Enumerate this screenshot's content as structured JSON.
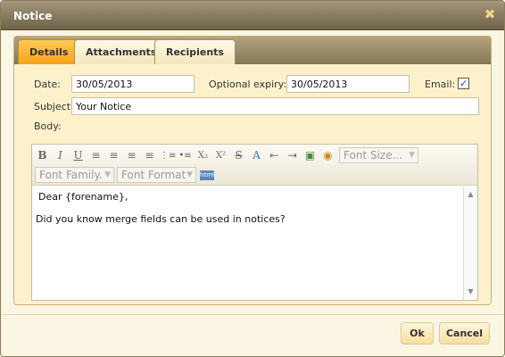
{
  "dialog": {
    "title": "Notice",
    "close_icon": "✖"
  },
  "tabs": [
    {
      "label": "Details",
      "active": true
    },
    {
      "label": "Attachments",
      "active": false
    },
    {
      "label": "Recipients",
      "active": false
    }
  ],
  "form": {
    "date_label": "Date:",
    "date_value": "30/05/2013",
    "expiry_label": "Optional expiry:",
    "expiry_value": "30/05/2013",
    "email_label": "Email:",
    "email_checked": true,
    "email_check_glyph": "✓",
    "subject_label": "Subject",
    "subject_value": "Your Notice",
    "body_label": "Body:"
  },
  "editor": {
    "toolbar": {
      "buttons": [
        {
          "name": "bold-icon",
          "glyph": "B"
        },
        {
          "name": "italic-icon",
          "glyph": "I"
        },
        {
          "name": "underline-icon",
          "glyph": "U"
        },
        {
          "name": "align-left-icon",
          "glyph": "≡"
        },
        {
          "name": "align-center-icon",
          "glyph": "≡"
        },
        {
          "name": "align-right-icon",
          "glyph": "≡"
        },
        {
          "name": "align-justify-icon",
          "glyph": "≡"
        },
        {
          "name": "ordered-list-icon",
          "glyph": "⋮≡"
        },
        {
          "name": "unordered-list-icon",
          "glyph": "•≡"
        },
        {
          "name": "subscript-icon",
          "glyph": "X₂"
        },
        {
          "name": "superscript-icon",
          "glyph": "X²"
        },
        {
          "name": "strikethrough-icon",
          "glyph": "S"
        },
        {
          "name": "clear-format-icon",
          "glyph": "A"
        },
        {
          "name": "outdent-icon",
          "glyph": "⇤"
        },
        {
          "name": "indent-icon",
          "glyph": "⇥"
        },
        {
          "name": "insert-image-icon",
          "glyph": "▣"
        },
        {
          "name": "color-palette-icon",
          "glyph": "◉"
        }
      ],
      "font_size": "Font Size...",
      "font_family": "Font Family.",
      "font_format": "Font Format",
      "html_toggle_icon": "html"
    },
    "content": [
      "Dear {forename},",
      "Did you know merge fields can be used in notices?"
    ]
  },
  "buttons": {
    "ok": "Ok",
    "cancel": "Cancel"
  },
  "colors": {
    "active_tab": "#f4a21a",
    "panel_bg": "#fdf1cc",
    "titlebar": "#857756"
  }
}
